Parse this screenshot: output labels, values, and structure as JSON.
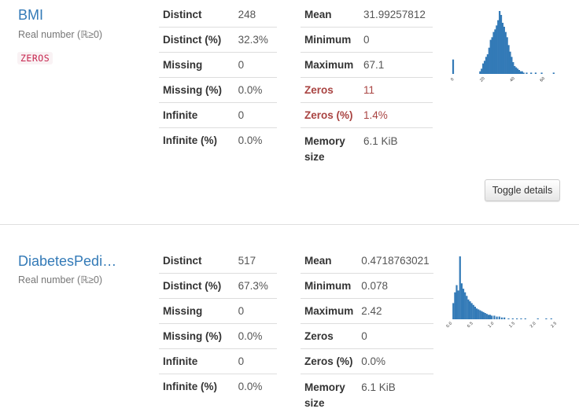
{
  "variables": [
    {
      "name": "BMI",
      "type": "Real number (ℝ≥0)",
      "badge": "ZEROS",
      "stats_left": [
        {
          "label": "Distinct",
          "value": "248"
        },
        {
          "label": "Distinct (%)",
          "value": "32.3%"
        },
        {
          "label": "Missing",
          "value": "0"
        },
        {
          "label": "Missing (%)",
          "value": "0.0%"
        },
        {
          "label": "Infinite",
          "value": "0"
        },
        {
          "label": "Infinite (%)",
          "value": "0.0%"
        }
      ],
      "stats_right": [
        {
          "label": "Mean",
          "value": "31.99257812"
        },
        {
          "label": "Minimum",
          "value": "0"
        },
        {
          "label": "Maximum",
          "value": "67.1"
        },
        {
          "label": "Zeros",
          "value": "11"
        },
        {
          "label": "Zeros (%)",
          "value": "1.4%"
        },
        {
          "label": "Memory size",
          "value": "6.1 KiB"
        }
      ],
      "toggle_label": "Toggle details",
      "chart_data": {
        "type": "bar",
        "title": "",
        "x_ticks": [
          "0",
          "20",
          "40",
          "60"
        ],
        "xlim": [
          0,
          67.1
        ],
        "bins": [
          {
            "x": 0.0,
            "count": 11
          },
          {
            "x": 18.0,
            "count": 2
          },
          {
            "x": 19.0,
            "count": 4
          },
          {
            "x": 20.0,
            "count": 8
          },
          {
            "x": 21.0,
            "count": 10
          },
          {
            "x": 22.0,
            "count": 13
          },
          {
            "x": 23.0,
            "count": 15
          },
          {
            "x": 24.0,
            "count": 20
          },
          {
            "x": 25.0,
            "count": 26
          },
          {
            "x": 26.0,
            "count": 28
          },
          {
            "x": 27.0,
            "count": 32
          },
          {
            "x": 28.0,
            "count": 34
          },
          {
            "x": 29.0,
            "count": 37
          },
          {
            "x": 30.0,
            "count": 41
          },
          {
            "x": 31.0,
            "count": 48
          },
          {
            "x": 32.0,
            "count": 45
          },
          {
            "x": 33.0,
            "count": 39
          },
          {
            "x": 34.0,
            "count": 36
          },
          {
            "x": 35.0,
            "count": 32
          },
          {
            "x": 36.0,
            "count": 28
          },
          {
            "x": 37.0,
            "count": 22
          },
          {
            "x": 38.0,
            "count": 17
          },
          {
            "x": 39.0,
            "count": 13
          },
          {
            "x": 40.0,
            "count": 9
          },
          {
            "x": 41.0,
            "count": 6
          },
          {
            "x": 42.0,
            "count": 5
          },
          {
            "x": 43.0,
            "count": 4
          },
          {
            "x": 44.0,
            "count": 3
          },
          {
            "x": 45.0,
            "count": 2
          },
          {
            "x": 46.0,
            "count": 2
          },
          {
            "x": 47.0,
            "count": 1
          },
          {
            "x": 49.0,
            "count": 1
          },
          {
            "x": 52.0,
            "count": 1
          },
          {
            "x": 55.0,
            "count": 1
          },
          {
            "x": 59.0,
            "count": 1
          },
          {
            "x": 67.0,
            "count": 1
          }
        ]
      }
    },
    {
      "name": "DiabetesPedi…",
      "type": "Real number (ℝ≥0)",
      "stats_left": [
        {
          "label": "Distinct",
          "value": "517"
        },
        {
          "label": "Distinct (%)",
          "value": "67.3%"
        },
        {
          "label": "Missing",
          "value": "0"
        },
        {
          "label": "Missing (%)",
          "value": "0.0%"
        },
        {
          "label": "Infinite",
          "value": "0"
        },
        {
          "label": "Infinite (%)",
          "value": "0.0%"
        }
      ],
      "stats_right": [
        {
          "label": "Mean",
          "value": "0.4718763021"
        },
        {
          "label": "Minimum",
          "value": "0.078"
        },
        {
          "label": "Maximum",
          "value": "2.42"
        },
        {
          "label": "Zeros",
          "value": "0"
        },
        {
          "label": "Zeros (%)",
          "value": "0.0%"
        },
        {
          "label": "Memory size",
          "value": "6.1 KiB"
        }
      ],
      "chart_data": {
        "type": "bar",
        "title": "",
        "x_ticks": [
          "0.0",
          "0.5",
          "1.0",
          "1.5",
          "2.0",
          "2.5"
        ],
        "xlim": [
          0.0,
          2.5
        ],
        "bins": [
          {
            "x": 0.08,
            "count": 18
          },
          {
            "x": 0.12,
            "count": 30
          },
          {
            "x": 0.16,
            "count": 38
          },
          {
            "x": 0.2,
            "count": 32
          },
          {
            "x": 0.24,
            "count": 70
          },
          {
            "x": 0.28,
            "count": 40
          },
          {
            "x": 0.32,
            "count": 34
          },
          {
            "x": 0.36,
            "count": 30
          },
          {
            "x": 0.4,
            "count": 26
          },
          {
            "x": 0.44,
            "count": 22
          },
          {
            "x": 0.48,
            "count": 20
          },
          {
            "x": 0.52,
            "count": 18
          },
          {
            "x": 0.56,
            "count": 16
          },
          {
            "x": 0.6,
            "count": 14
          },
          {
            "x": 0.64,
            "count": 12
          },
          {
            "x": 0.68,
            "count": 11
          },
          {
            "x": 0.72,
            "count": 10
          },
          {
            "x": 0.76,
            "count": 9
          },
          {
            "x": 0.8,
            "count": 8
          },
          {
            "x": 0.84,
            "count": 7
          },
          {
            "x": 0.88,
            "count": 6
          },
          {
            "x": 0.92,
            "count": 5
          },
          {
            "x": 0.96,
            "count": 5
          },
          {
            "x": 1.0,
            "count": 4
          },
          {
            "x": 1.06,
            "count": 4
          },
          {
            "x": 1.12,
            "count": 3
          },
          {
            "x": 1.18,
            "count": 3
          },
          {
            "x": 1.24,
            "count": 2
          },
          {
            "x": 1.3,
            "count": 2
          },
          {
            "x": 1.4,
            "count": 1
          },
          {
            "x": 1.5,
            "count": 1
          },
          {
            "x": 1.6,
            "count": 1
          },
          {
            "x": 1.7,
            "count": 1
          },
          {
            "x": 1.8,
            "count": 1
          },
          {
            "x": 2.1,
            "count": 1
          },
          {
            "x": 2.3,
            "count": 1
          },
          {
            "x": 2.42,
            "count": 1
          }
        ]
      }
    }
  ],
  "colors": {
    "link": "#337ab7",
    "bar": "#337ab7",
    "alert": "#a94442"
  }
}
